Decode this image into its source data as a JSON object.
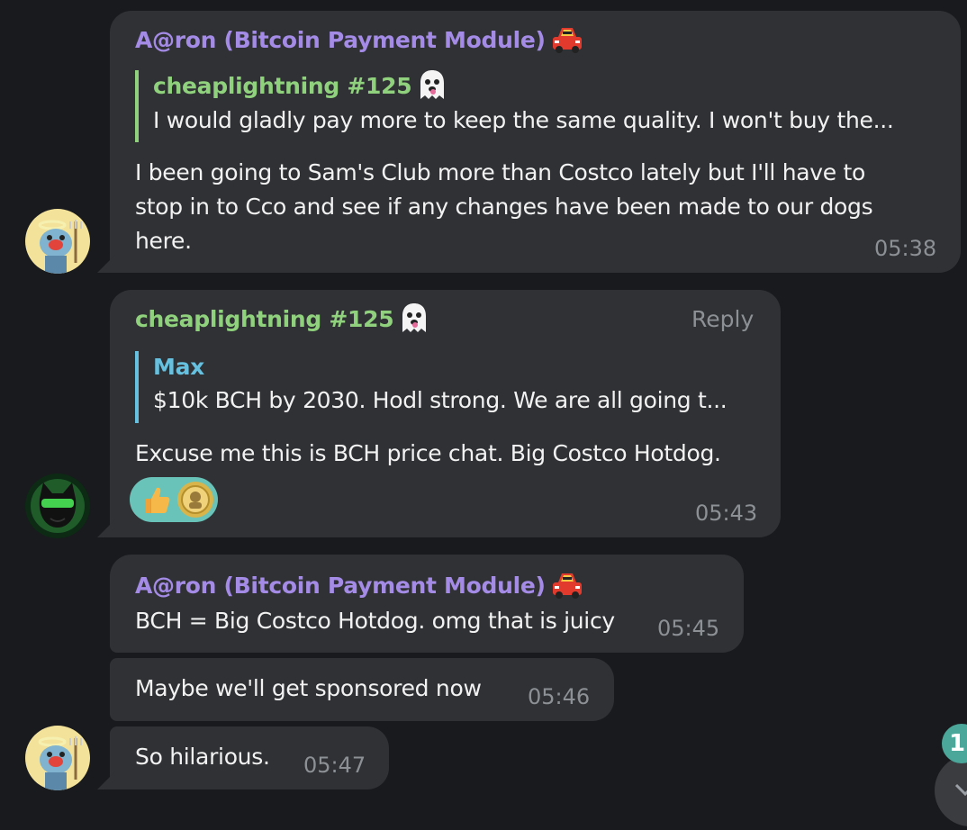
{
  "messages": [
    {
      "sender": "A@ron (Bitcoin Payment Module)",
      "sender_emoji": "car-emoji",
      "reply_to": {
        "name": "cheaplightning #125",
        "name_emoji": "ghost-emoji",
        "text": "I would gladly pay more to keep the same quality. I won't buy the..."
      },
      "lines": [
        "I been going to Sam's Club more than Costco lately but I'll have to",
        "stop in to Cco and see if any changes have been made to our dogs",
        "here."
      ],
      "time": "05:38"
    },
    {
      "sender": "cheaplightning #125",
      "sender_emoji": "ghost-emoji",
      "reply_label": "Reply",
      "reply_to": {
        "name": "Max",
        "text": "$10k BCH by 2030. Hodl strong. We are all going t..."
      },
      "text": "Excuse me this is BCH price chat.  Big Costco Hotdog.",
      "reactions": [
        "thumbs-up-emoji",
        "coin-sticker"
      ],
      "time": "05:43"
    },
    {
      "sender": "A@ron (Bitcoin Payment Module)",
      "sender_emoji": "car-emoji",
      "text": "BCH = Big Costco Hotdog. omg that is juicy",
      "time": "05:45"
    },
    {
      "text": "Maybe we'll get sponsored now",
      "time": "05:46"
    },
    {
      "text": "So hilarious.",
      "time": "05:47"
    }
  ],
  "unread_count": "1",
  "colors": {
    "background": "#191a1d",
    "bubble": "#2f3134",
    "purple_name": "#a48be6",
    "green_name": "#8fd17d",
    "blue_name": "#66c0df",
    "time": "#8d9196",
    "reaction_bg": "#69c3b9",
    "badge": "#4aa79a"
  }
}
